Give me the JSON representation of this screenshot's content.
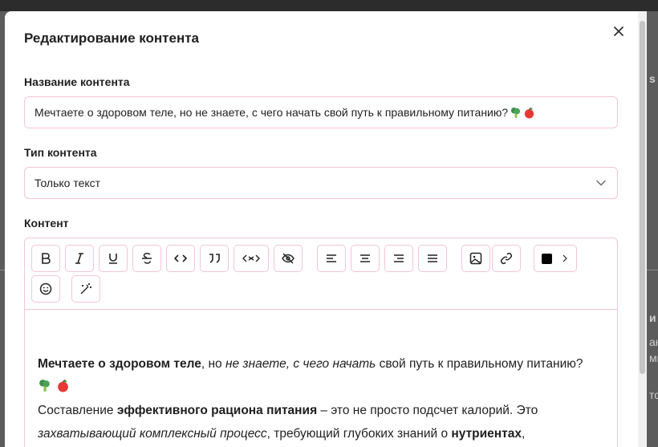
{
  "modal": {
    "title": "Редактирование контента",
    "close_label": "×"
  },
  "form": {
    "name_label": "Название контента",
    "name_value": "Мечтаете о здоровом теле, но не знаете, с чего начать свой путь к правильному питанию?",
    "type_label": "Тип контента",
    "type_value": "Только текст",
    "content_label": "Контент"
  },
  "toolbar": {
    "buttons": [
      "bold",
      "italic",
      "underline",
      "strikethrough",
      "code",
      "quote",
      "code-block",
      "hide",
      "align-left",
      "align-center",
      "align-right",
      "align-justify",
      "image",
      "link",
      "text-color",
      "emoji",
      "magic"
    ],
    "text_color": "#000000"
  },
  "content": {
    "p1_bold": "Мечтаете о здоровом теле",
    "p1_t1": ", но ",
    "p1_italic": "не знаете, с чего начать",
    "p1_t2": " свой путь к правильному питанию?",
    "p2_t1": "Составление ",
    "p2_bold1": "эффективного рациона питания",
    "p2_t2": " – это не просто подсчет калорий. Это",
    "p3_italic": "захватывающий комплексный процесс",
    "p3_t1": ", требующий глубоких знаний о ",
    "p3_bold": "нутриентах",
    "p3_t2": ","
  },
  "background": {
    "frag_right_1": "s",
    "frag_right_2": "и",
    "frag_right_3": "ан",
    "frag_right_4": "мни",
    "frag_right_5": "тове"
  },
  "colors": {
    "accent_border": "#f3c6d3",
    "overlay": "#5c5c5c"
  }
}
